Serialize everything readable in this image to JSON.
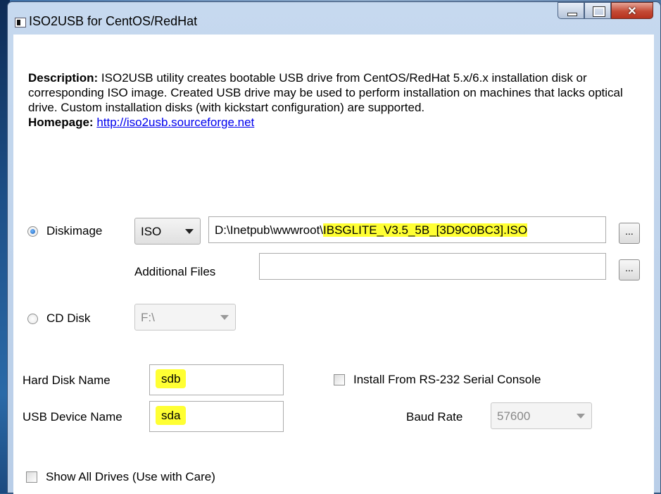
{
  "window": {
    "title": "ISO2USB for CentOS/RedHat"
  },
  "description": {
    "label": "Description:",
    "text": "ISO2USB utility creates bootable USB drive from CentOS/RedHat 5.x/6.x installation disk or corresponding ISO image. Created USB drive may be used to perform installation on machines that lacks optical drive. Custom installation disks (with kickstart configuration) are supported.",
    "homepage_label": "Homepage:",
    "homepage_url": "http://iso2usb.sourceforge.net"
  },
  "source": {
    "diskimage": {
      "label": "Diskimage",
      "selected": true,
      "type_value": "ISO",
      "path_prefix": "D:\\Inetpub\\wwwroot\\",
      "path_highlighted": "IBSGLITE_V3.5_5B_[3D9C0BC3].ISO",
      "browse_label": "..."
    },
    "additional_files": {
      "label": "Additional Files",
      "value": "",
      "browse_label": "..."
    },
    "cd_disk": {
      "label": "CD Disk",
      "selected": false,
      "drive_value": "F:\\"
    }
  },
  "hard_disk_name": {
    "label": "Hard Disk Name",
    "value": "sdb"
  },
  "usb_device_name": {
    "label": "USB Device Name",
    "value": "sda"
  },
  "serial_console": {
    "label": "Install From RS-232 Serial Console",
    "checked": false
  },
  "baud_rate": {
    "label": "Baud Rate",
    "value": "57600"
  },
  "show_all_drives": {
    "label": "Show All Drives (Use with Care)",
    "checked": false
  },
  "colors": {
    "highlight": "#ffff33",
    "link": "#0000ee",
    "close_button": "#c44a35"
  }
}
